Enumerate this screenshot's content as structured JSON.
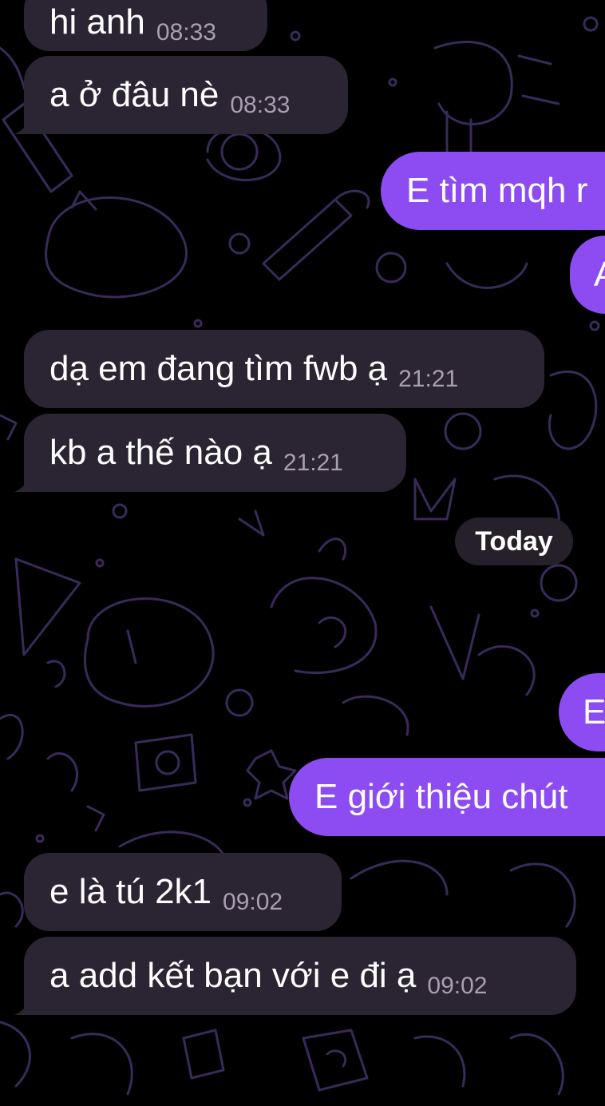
{
  "messages": [
    {
      "side": "in",
      "text": "hi anh",
      "time": "08:33"
    },
    {
      "side": "in",
      "text": "a ở đâu nè",
      "time": "08:33"
    },
    {
      "side": "out",
      "text": "E tìm mqh r"
    },
    {
      "side": "out",
      "text": "A"
    },
    {
      "side": "in",
      "text": "dạ em đang tìm fwb ạ",
      "time": "21:21"
    },
    {
      "side": "in",
      "text": "kb a thế nào ạ",
      "time": "21:21"
    },
    {
      "side": "out",
      "text": "E"
    },
    {
      "side": "out",
      "text": "E giới thiệu chút"
    },
    {
      "side": "in",
      "text": "e là tú 2k1",
      "time": "09:02"
    },
    {
      "side": "in",
      "text": "a add kết bạn với e đi ạ",
      "time": "09:02"
    }
  ],
  "date_separator": "Today",
  "colors": {
    "background": "#000000",
    "incoming_bubble": "#2b2433",
    "outgoing_bubble": "#8d4cf1",
    "timestamp": "#a99fb2",
    "doodle_stroke": "#3a2a5a"
  }
}
